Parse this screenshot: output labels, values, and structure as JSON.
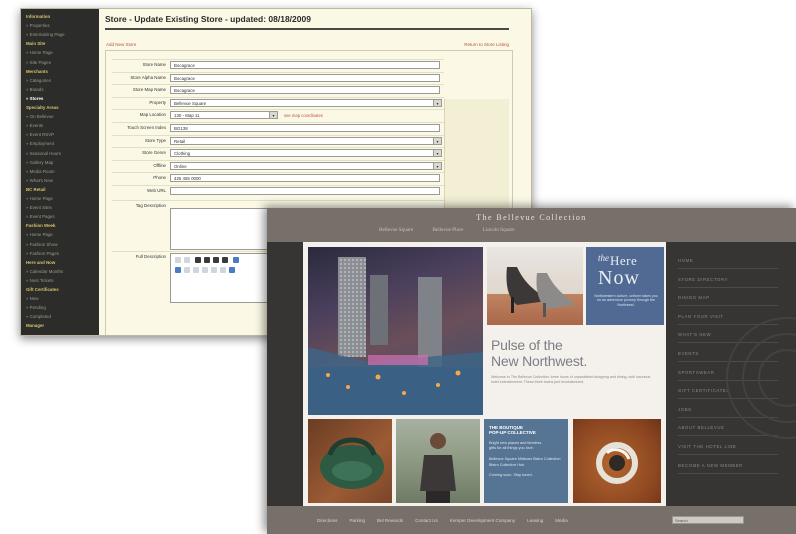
{
  "admin": {
    "title": "Store - Update Existing Store - updated: 08/18/2009",
    "sub_left": "Add New Store",
    "sub_right": "Return to Store Listing",
    "sidebar": [
      {
        "label": "Information",
        "kind": "hd"
      },
      {
        "label": "» Properties",
        "kind": "item"
      },
      {
        "label": "» Entertaining Page",
        "kind": "item"
      },
      {
        "label": "Main Site",
        "kind": "hd"
      },
      {
        "label": "» Home Page",
        "kind": "item"
      },
      {
        "label": "» Site Pages",
        "kind": "item"
      },
      {
        "label": "Merchants",
        "kind": "hd"
      },
      {
        "label": "» Categories",
        "kind": "item"
      },
      {
        "label": "» Brands",
        "kind": "item"
      },
      {
        "label": "» Stores",
        "kind": "active"
      },
      {
        "label": "Specialty Areas",
        "kind": "hd"
      },
      {
        "label": "» On Bellevue",
        "kind": "item"
      },
      {
        "label": "» Events",
        "kind": "item"
      },
      {
        "label": "» Event RSVP",
        "kind": "item"
      },
      {
        "label": "» Employment",
        "kind": "item"
      },
      {
        "label": "» Seasonal Hours",
        "kind": "item"
      },
      {
        "label": "» Gallery Map",
        "kind": "item"
      },
      {
        "label": "» Media Room",
        "kind": "item"
      },
      {
        "label": "» What's New",
        "kind": "item"
      },
      {
        "label": "BC Retail",
        "kind": "hd"
      },
      {
        "label": "» Home Page",
        "kind": "item"
      },
      {
        "label": "» Event Sites",
        "kind": "item"
      },
      {
        "label": "» Event Pages",
        "kind": "item"
      },
      {
        "label": "Fashion Week",
        "kind": "hd"
      },
      {
        "label": "» Home Page",
        "kind": "item"
      },
      {
        "label": "» Fashion Show",
        "kind": "item"
      },
      {
        "label": "» Fashion Pages",
        "kind": "item"
      },
      {
        "label": "Here and Now",
        "kind": "hd"
      },
      {
        "label": "» Calendar Months",
        "kind": "item"
      },
      {
        "label": "» Nest Tickets",
        "kind": "item"
      },
      {
        "label": "Gift Certificates",
        "kind": "hd"
      },
      {
        "label": "» New",
        "kind": "item"
      },
      {
        "label": "» Pending",
        "kind": "item"
      },
      {
        "label": "» Completed",
        "kind": "item"
      },
      {
        "label": "Manager",
        "kind": "hd"
      }
    ],
    "fields": [
      {
        "label": "Store Name",
        "value": "Bocagrace",
        "width": 270
      },
      {
        "label": "Store Alpha Name",
        "value": "Bocagrace",
        "width": 270
      },
      {
        "label": "Store Map Name",
        "value": "Bocagrace",
        "width": 270
      },
      {
        "label": "Property",
        "value": "Bellevue Square",
        "width": 272,
        "dropdown": true
      },
      {
        "label": "Map Location",
        "value": "130 - Map 11",
        "width": 108,
        "dropdown": true,
        "note": "see map coordinates"
      },
      {
        "label": "Touch Screen Index",
        "value": "BG138",
        "width": 270
      },
      {
        "label": "Store Type",
        "value": "Retail",
        "width": 272,
        "dropdown": true
      },
      {
        "label": "Store Genre",
        "value": "Clothing",
        "width": 272,
        "dropdown": true
      },
      {
        "label": "Offline",
        "value": "Online",
        "width": 272,
        "dropdown": true
      },
      {
        "label": "Phone",
        "value": "425 455 0000",
        "width": 270
      },
      {
        "label": "Web URL",
        "value": "",
        "width": 270
      }
    ],
    "short_desc_label": "Tag Description",
    "full_desc_label": "Full Description"
  },
  "site": {
    "title": "The Bellevue Collection",
    "topnav": [
      "Bellevue Square",
      "Bellevue Place",
      "Lincoln Square"
    ],
    "rightnav": [
      "HOME",
      "STORE DIRECTORY",
      "DINING MAP",
      "PLAN YOUR VISIT",
      "WHAT'S NEW",
      "EVENTS",
      "SPORTSWEAR",
      "GIFT CERTIFICATES",
      "JOBS",
      "ABOUT BELLEVUE",
      "VISIT THE HOTEL LINE",
      "BECOME A NEW MEMBER"
    ],
    "footer_links": [
      "Directions",
      "Parking",
      "Bel Rewards",
      "Contact Us",
      "Kemper Development Company",
      "Leasing",
      "Media"
    ],
    "search_placeholder": "Search",
    "pulse_line1": "Pulse of the",
    "pulse_line2": "New Northwest.",
    "pulse_body": "Welcome to The Bellevue Collection: three hours of unparalleled shopping and dining, with luxurious hotel entertainment. These three towns just revolutionized.",
    "here_the": "the",
    "here_here": "Here",
    "here_now": "Now",
    "here_sub": "Northwestern culture, uniform takes you on an adventure journey through the Northwest.",
    "promo_title": "THE BOUTIQUE\nPOP-UP COLLECTIVE",
    "promo_lines": [
      "Bright new places and timeless",
      "gifts for all things you love.",
      "",
      "Bellevue Square Midtown Bistro Collection",
      "Bistro Collective Hub",
      "",
      "Coming soon. Stay tuned."
    ]
  }
}
